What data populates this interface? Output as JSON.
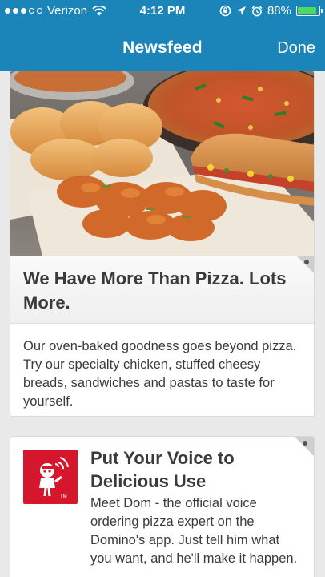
{
  "status_bar": {
    "carrier": "Verizon",
    "time": "4:12 PM",
    "battery_percent": "88%",
    "battery_level": 0.88,
    "icons": [
      "signal-dots-icon",
      "wifi-icon",
      "rotation-lock-icon",
      "location-arrow-icon",
      "alarm-icon",
      "battery-icon"
    ]
  },
  "nav": {
    "title": "Newsfeed",
    "done_label": "Done"
  },
  "cards": [
    {
      "image": "pizza-food-photo",
      "headline": "We Have More Than Pizza. Lots More.",
      "body": "Our oven-baked goodness goes beyond pizza. Try our specialty chicken, stuffed cheesy breads, sandwiches and pastas to taste for yourself."
    },
    {
      "image": "dom-voice-logo-icon",
      "headline": "Put Your Voice to Delicious Use",
      "body": "Meet Dom - the official voice ordering pizza expert on the Domino's app. Just tell him what you want, and he'll make it happen."
    }
  ],
  "colors": {
    "header_blue": "#1b84b8",
    "brand_red": "#d6162c",
    "battery_green": "#4cd964"
  }
}
